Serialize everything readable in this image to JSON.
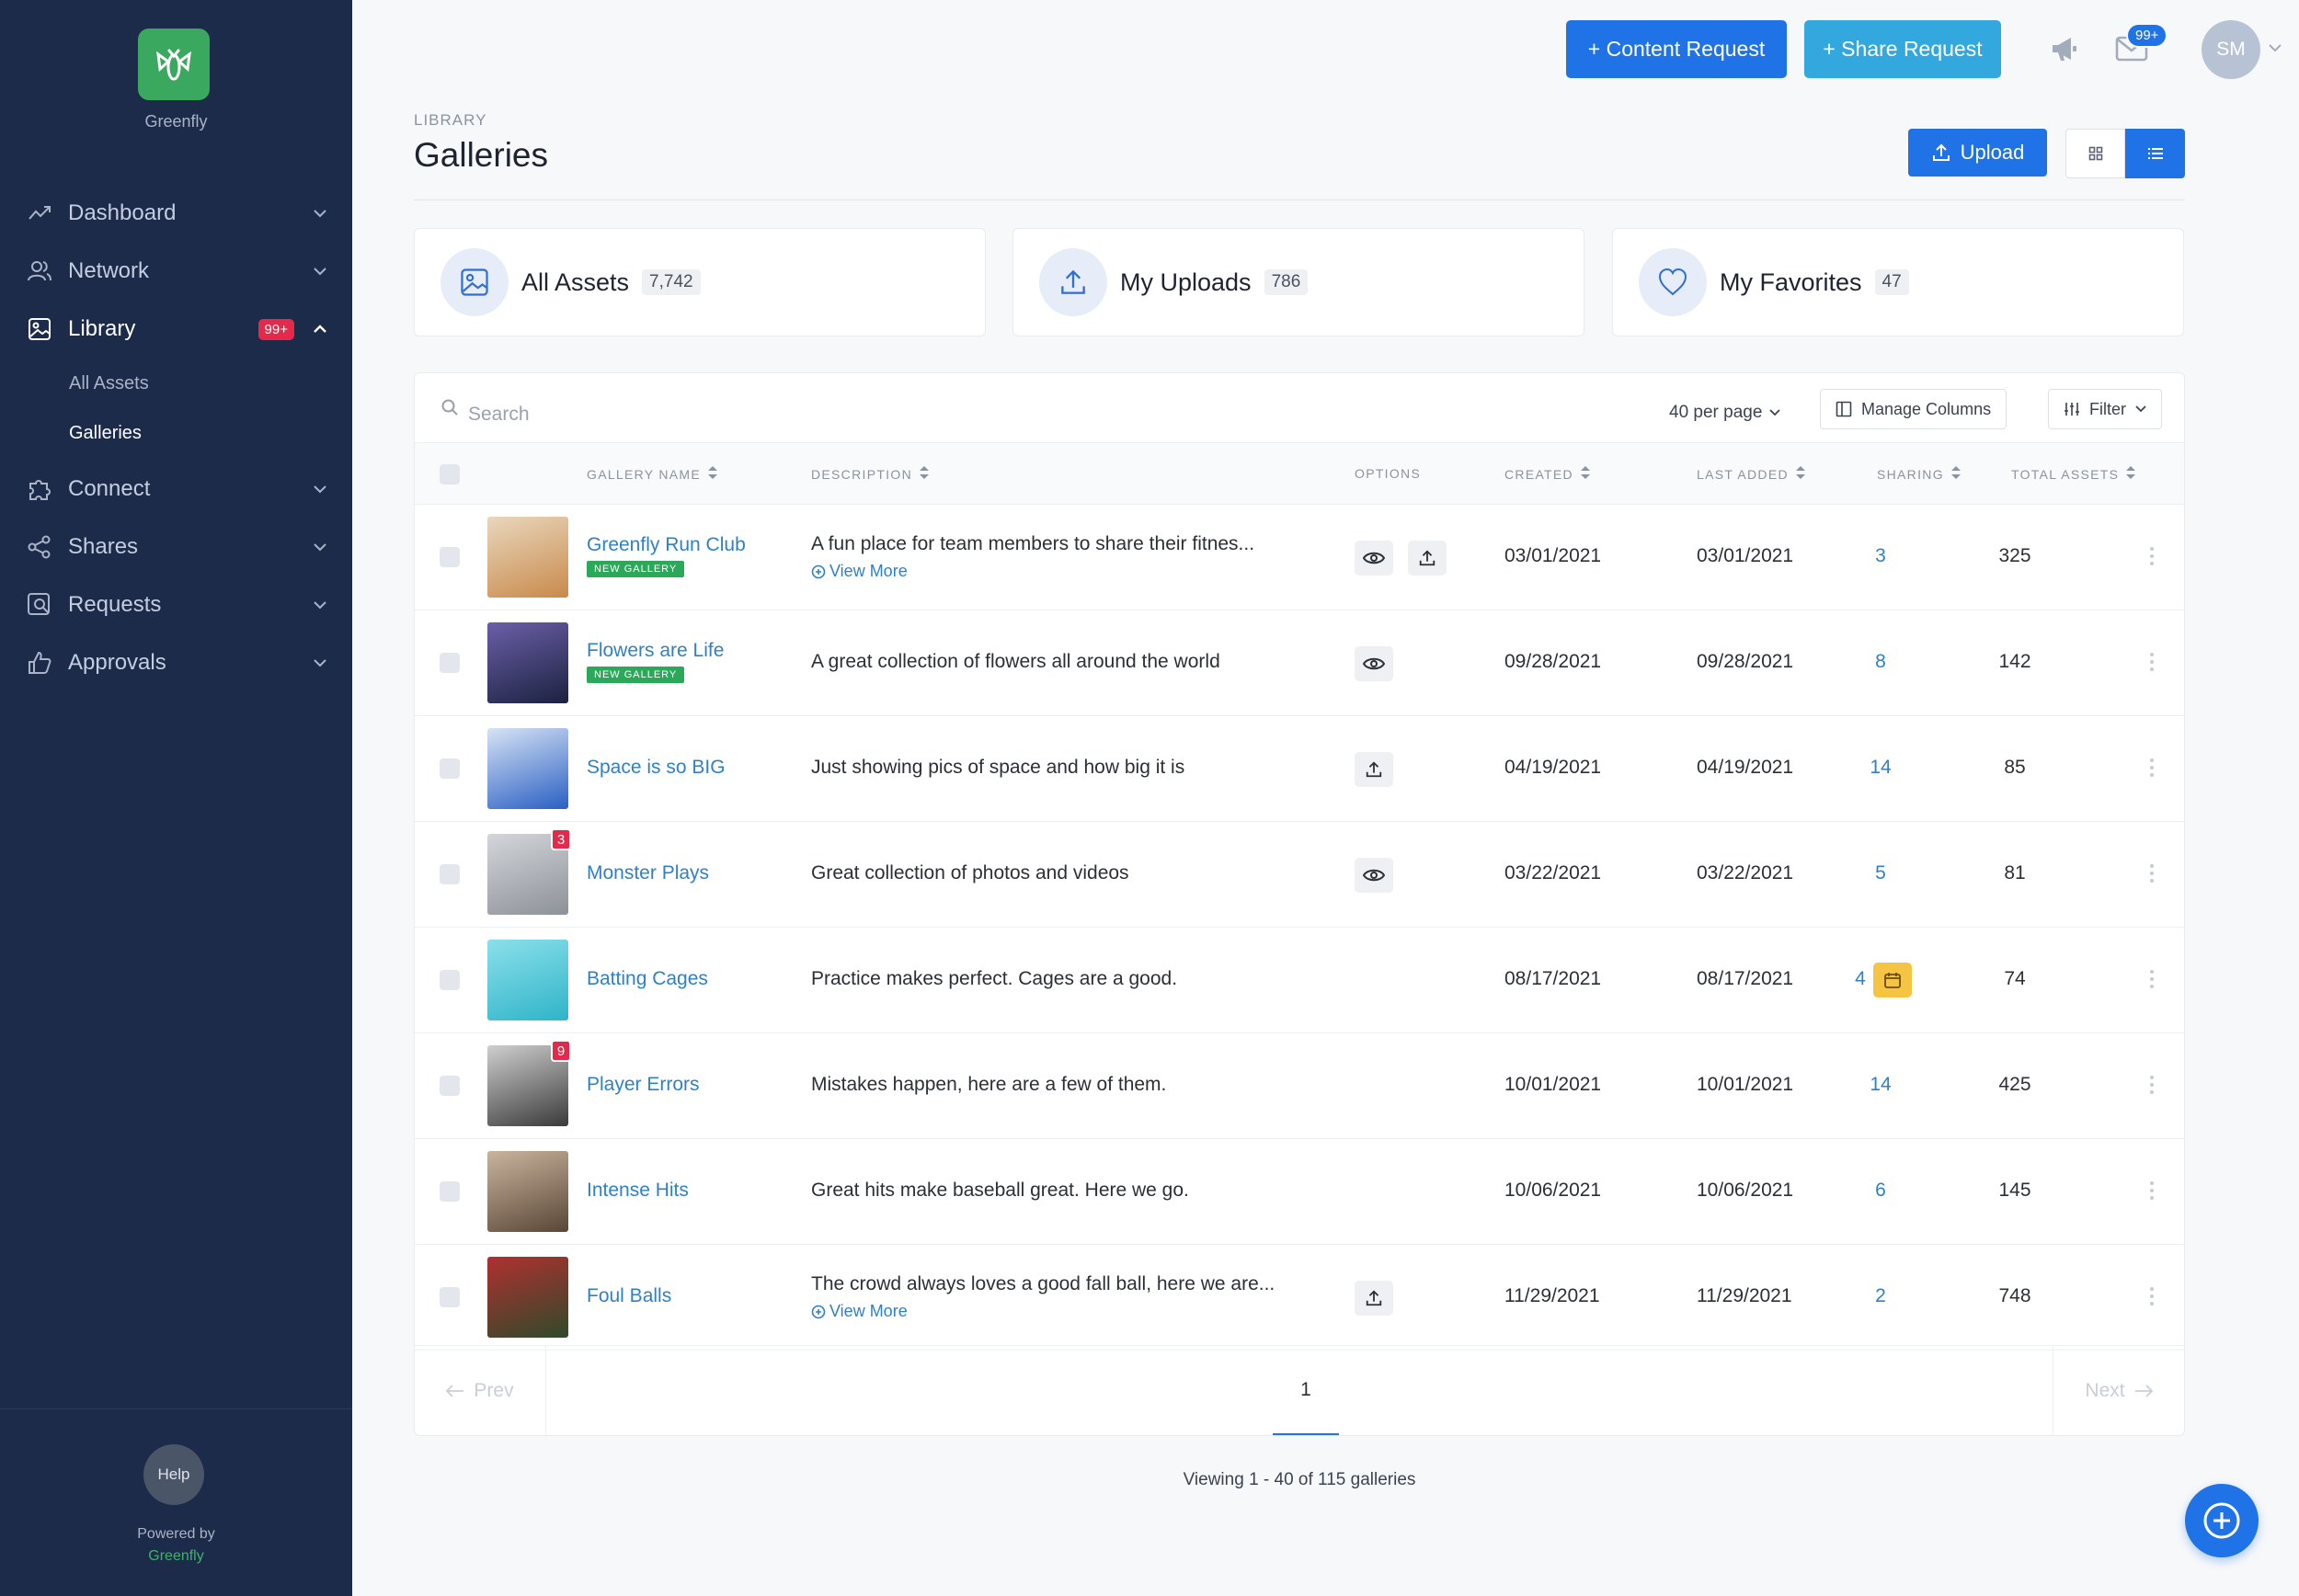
{
  "sidebar": {
    "brand": "Greenfly",
    "items": [
      {
        "label": "Dashboard",
        "icon": "trending-up-icon"
      },
      {
        "label": "Network",
        "icon": "users-icon"
      },
      {
        "label": "Library",
        "icon": "image-icon",
        "badge": "99+"
      },
      {
        "label": "Connect",
        "icon": "puzzle-icon"
      },
      {
        "label": "Shares",
        "icon": "share-icon"
      },
      {
        "label": "Requests",
        "icon": "search-image-icon"
      },
      {
        "label": "Approvals",
        "icon": "thumbs-up-icon"
      }
    ],
    "sub_items": [
      {
        "label": "All Assets"
      },
      {
        "label": "Galleries"
      }
    ],
    "help": "Help",
    "powered_by": "Powered by",
    "powered_brand": "Greenfly"
  },
  "topbar": {
    "content_request": "+ Content Request",
    "share_request": "+ Share Request",
    "mail_badge": "99+",
    "avatar_initials": "SM"
  },
  "header": {
    "breadcrumb": "LIBRARY",
    "title": "Galleries",
    "upload": "Upload"
  },
  "stats": [
    {
      "label": "All Assets",
      "count": "7,742",
      "icon": "image-icon"
    },
    {
      "label": "My Uploads",
      "count": "786",
      "icon": "upload-icon"
    },
    {
      "label": "My Favorites",
      "count": "47",
      "icon": "heart-icon"
    }
  ],
  "toolbar": {
    "search_placeholder": "Search",
    "per_page": "40 per page",
    "manage_columns": "Manage Columns",
    "filter": "Filter"
  },
  "columns": {
    "gallery_name": "GALLERY NAME",
    "description": "DESCRIPTION",
    "options": "OPTIONS",
    "created": "CREATED",
    "last_added": "LAST ADDED",
    "sharing": "SHARING",
    "total_assets": "TOTAL ASSETS"
  },
  "rows": [
    {
      "name": "Greenfly Run Club",
      "tag": "NEW GALLERY",
      "description": "A fun place for team members to share their fitnes...",
      "view_more": "View More",
      "created": "03/01/2021",
      "last_added": "03/01/2021",
      "sharing": "3",
      "total": "325",
      "thumb_colors": [
        "#c98a4b",
        "#e9d7bd"
      ]
    },
    {
      "name": "Flowers are Life",
      "tag": "NEW GALLERY",
      "description": "A great collection of flowers all around the world",
      "created": "09/28/2021",
      "last_added": "09/28/2021",
      "sharing": "8",
      "total": "142",
      "thumb_colors": [
        "#1b2240",
        "#6b5fa8"
      ]
    },
    {
      "name": "Space is so BIG",
      "description": "Just showing pics of space and how big it is",
      "created": "04/19/2021",
      "last_added": "04/19/2021",
      "sharing": "14",
      "total": "85",
      "thumb_colors": [
        "#2a5fc4",
        "#d6e3f5"
      ]
    },
    {
      "name": "Monster Plays",
      "thumb_badge": "3",
      "description": "Great collection of photos and videos",
      "created": "03/22/2021",
      "last_added": "03/22/2021",
      "sharing": "5",
      "total": "81",
      "thumb_colors": [
        "#8d9198",
        "#d3d6da"
      ]
    },
    {
      "name": "Batting Cages",
      "description": "Practice makes perfect. Cages are a good.",
      "created": "08/17/2021",
      "last_added": "08/17/2021",
      "sharing": "4",
      "total": "74",
      "thumb_colors": [
        "#2fb4c9",
        "#8be0ea"
      ]
    },
    {
      "name": "Player Errors",
      "thumb_badge": "9",
      "description": "Mistakes happen, here are a few of them.",
      "created": "10/01/2021",
      "last_added": "10/01/2021",
      "sharing": "14",
      "total": "425",
      "thumb_colors": [
        "#3a3a3a",
        "#cfcfcf"
      ]
    },
    {
      "name": "Intense Hits",
      "description": "Great hits make baseball great. Here we go.",
      "created": "10/06/2021",
      "last_added": "10/06/2021",
      "sharing": "6",
      "total": "145",
      "thumb_colors": [
        "#5a4636",
        "#c9b59e"
      ]
    },
    {
      "name": "Foul Balls",
      "description": "The crowd always loves a good fall ball, here we are...",
      "view_more": "View More",
      "created": "11/29/2021",
      "last_added": "11/29/2021",
      "sharing": "2",
      "total": "748",
      "thumb_colors": [
        "#2f4a2a",
        "#b03030"
      ]
    }
  ],
  "pagination": {
    "prev": "Prev",
    "next": "Next",
    "page": "1",
    "viewing": "Viewing 1 - 40 of 115 galleries"
  },
  "colors": {
    "sidebar_bg": "#1c2b4a",
    "primary": "#1f73e6",
    "secondary": "#33a8df",
    "link": "#2f80c8",
    "badge_red": "#e5294a",
    "tag_green": "#2ca85a",
    "calendar_yellow": "#f6c443"
  }
}
